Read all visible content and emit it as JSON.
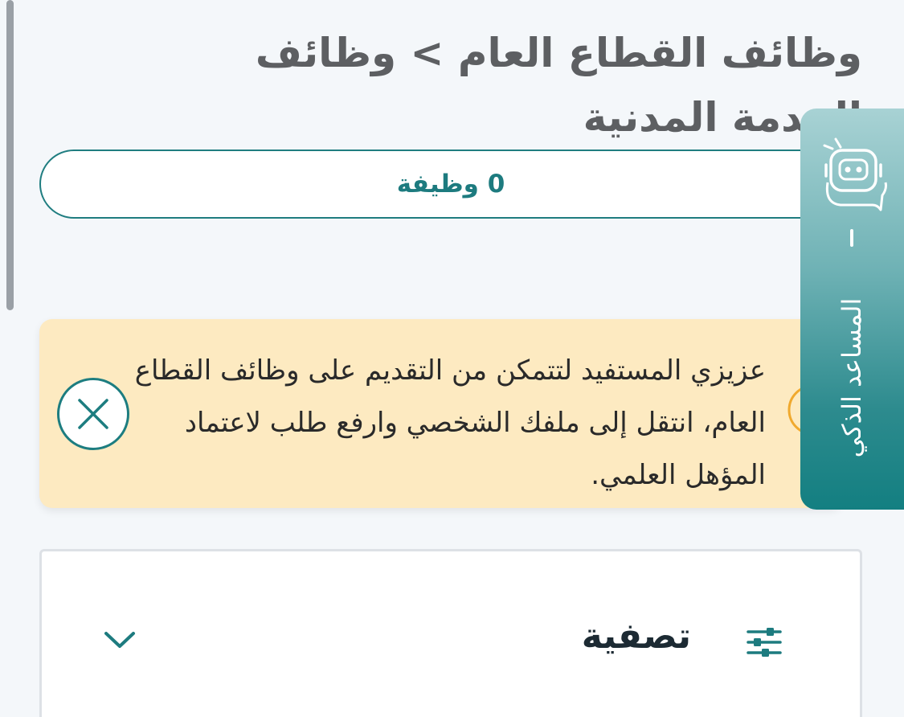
{
  "header": {
    "breadcrumb_title": "وظائف القطاع العام > وظائف الخدمة المدنية"
  },
  "jobs": {
    "count_label": "0 وظيفة"
  },
  "notice": {
    "message": "عزيزي المستفيد لتتمكن من التقديم على وظائف القطاع العام، انتقل إلى ملفك الشخصي وارفع طلب لاعتماد المؤهل العلمي."
  },
  "assistant": {
    "label": "المساعد الذكي"
  },
  "filter": {
    "title": "تصفية"
  },
  "icons": {
    "notice_warning": "exclamation-circle-icon",
    "notice_close": "close-icon",
    "assistant": "robot-icon",
    "filter": "sliders-icon",
    "expand": "chevron-down-icon"
  },
  "colors": {
    "teal": "#1d7b7f",
    "notice_bg": "#fdeac1",
    "warning": "#f0a92e",
    "title_gray": "#5d5f62"
  }
}
